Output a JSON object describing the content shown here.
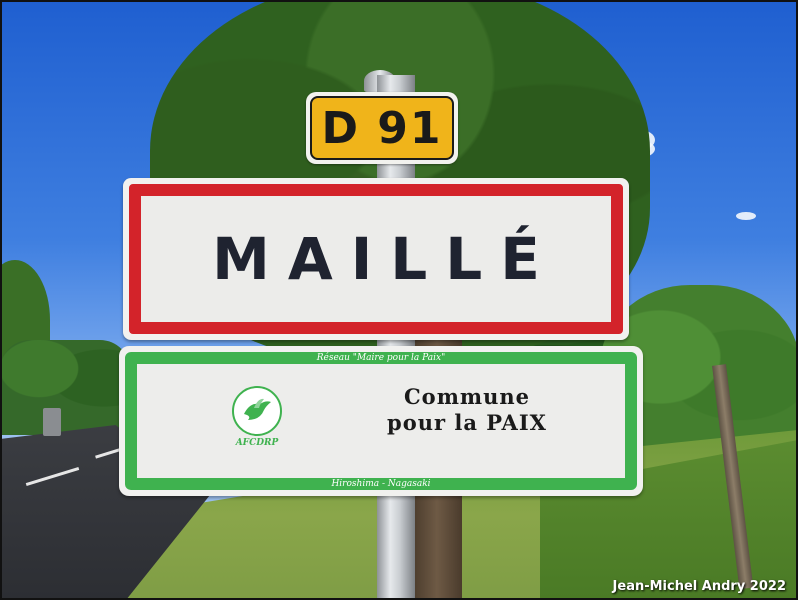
{
  "route_sign": {
    "text": "D 91",
    "color": "#f0b41a"
  },
  "town_sign": {
    "name": "MAILLÉ",
    "border_color": "#d3232a"
  },
  "peace_sign": {
    "top_text": "Réseau \"Maire pour la Paix\"",
    "line1": "Commune",
    "line2": "pour la PAIX",
    "bottom_text": "Hiroshima - Nagasaki",
    "logo_text": "AFCDRP",
    "border_color": "#3fb24f"
  },
  "credit": "Jean-Michel Andry 2022"
}
